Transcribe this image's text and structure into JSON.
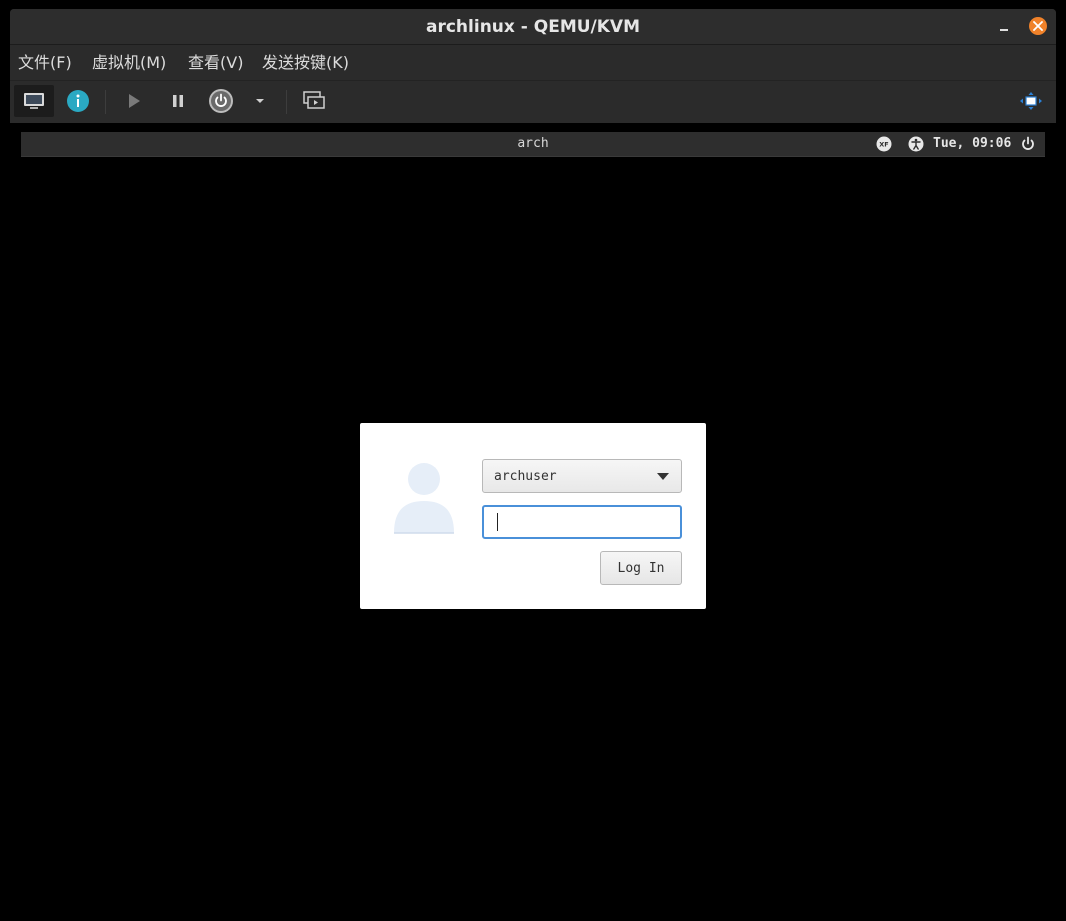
{
  "window": {
    "title": "archlinux - QEMU/KVM"
  },
  "menubar": {
    "items": [
      {
        "label": "文件(F)"
      },
      {
        "label": "虚拟机(M)"
      },
      {
        "label": "查看(V)"
      },
      {
        "label": "发送按键(K)"
      }
    ]
  },
  "toolbar": {
    "buttons": [
      "console-icon",
      "details-icon",
      "run-icon",
      "pause-icon",
      "power-icon",
      "dropdown-arrow-icon",
      "snapshot-icon",
      "fullscreen-icon"
    ]
  },
  "guest": {
    "panel": {
      "hostname": "arch",
      "clock": "Tue, 09:06"
    },
    "login": {
      "username": "archuser",
      "password_value": "",
      "button_label": "Log In"
    }
  },
  "colors": {
    "accent_orange": "#f0822a",
    "info_teal": "#2aa9c3",
    "focus_blue": "#4a90d9"
  }
}
